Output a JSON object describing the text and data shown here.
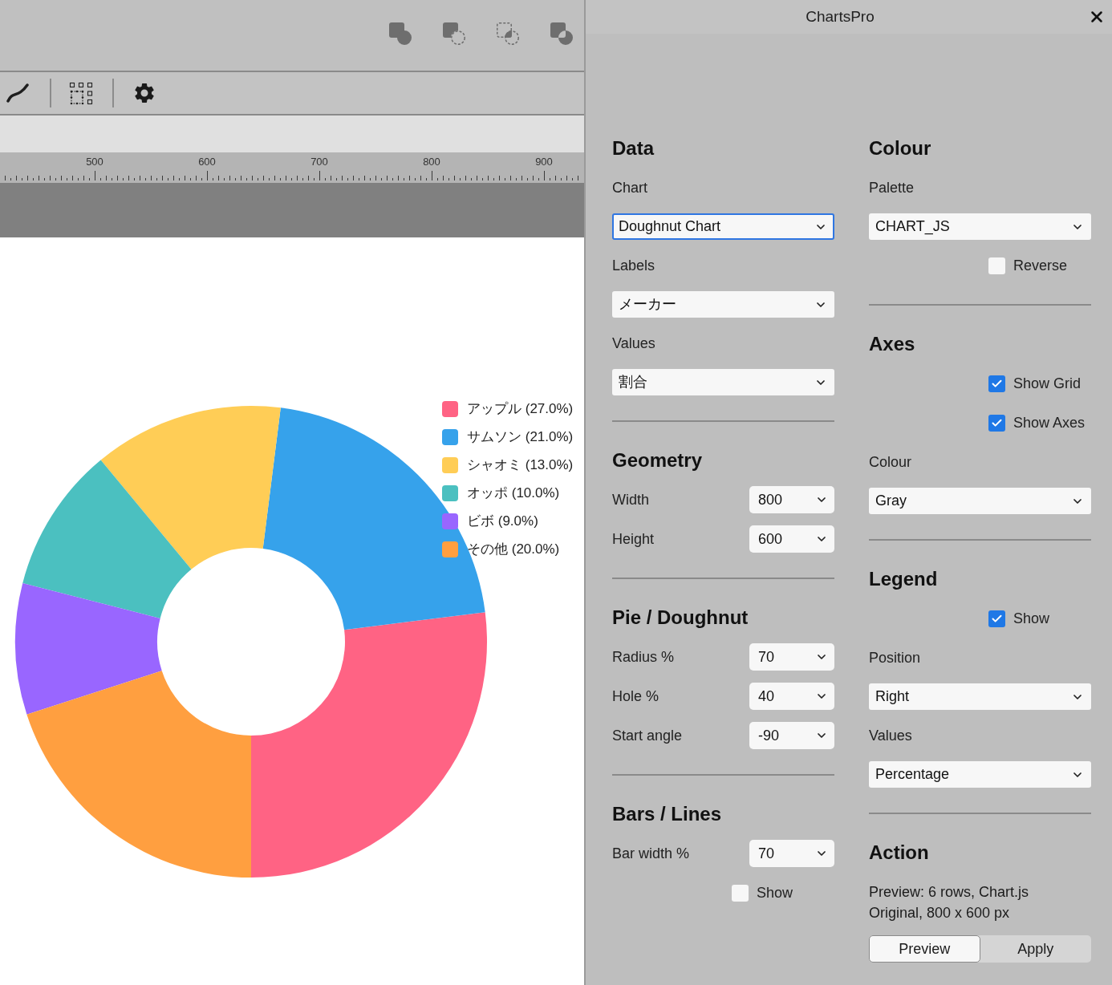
{
  "ruler": {
    "labels": [
      "500",
      "600",
      "700",
      "800",
      "900"
    ]
  },
  "chart": {
    "chart_data": {
      "type": "donut",
      "values": [
        27,
        21,
        13,
        10,
        9,
        20
      ]
    },
    "legend": [
      {
        "label": "アップル (27.0%)",
        "color": "#ff6384"
      },
      {
        "label": "サムソン (21.0%)",
        "color": "#36a2eb"
      },
      {
        "label": "シャオミ (13.0%)",
        "color": "#ffcd56"
      },
      {
        "label": "オッポ (10.0%)",
        "color": "#4bc0c0"
      },
      {
        "label": "ビボ (9.0%)",
        "color": "#9966ff"
      },
      {
        "label": "その他 (20.0%)",
        "color": "#ff9f40"
      }
    ]
  },
  "panel": {
    "title": "ChartsPro",
    "columns": [
      [
        {
          "heading": "Data",
          "items": [
            {
              "kind": "select",
              "label": "Chart",
              "value": "Doughnut Chart",
              "focused": true
            },
            {
              "kind": "select",
              "label": "Labels",
              "value": "メーカー",
              "focused": false
            },
            {
              "kind": "select",
              "label": "Values",
              "value": "割合",
              "focused": false
            }
          ]
        },
        {
          "heading": "Geometry",
          "items": [
            {
              "kind": "inline_select",
              "label": "Width",
              "value": "800"
            },
            {
              "kind": "inline_select",
              "label": "Height",
              "value": "600"
            }
          ]
        },
        {
          "heading": "Pie / Doughnut",
          "items": [
            {
              "kind": "inline_select",
              "label": "Radius %",
              "value": "70"
            },
            {
              "kind": "inline_select",
              "label": "Hole %",
              "value": "40"
            },
            {
              "kind": "inline_select",
              "label": "Start angle",
              "value": "-90"
            }
          ]
        },
        {
          "heading": "Bars / Lines",
          "items": [
            {
              "kind": "inline_select",
              "label": "Bar width %",
              "value": "70"
            },
            {
              "kind": "checkbox",
              "label": "Show",
              "checked": false
            }
          ]
        }
      ],
      [
        {
          "heading": "Colour",
          "items": [
            {
              "kind": "select",
              "label": "Palette",
              "value": "CHART_JS",
              "focused": false
            },
            {
              "kind": "checkbox",
              "label": "Reverse",
              "checked": false
            }
          ]
        },
        {
          "heading": "Axes",
          "items": [
            {
              "kind": "checkbox",
              "label": "Show Grid",
              "checked": true
            },
            {
              "kind": "checkbox",
              "label": "Show Axes",
              "checked": true
            },
            {
              "kind": "select",
              "label": "Colour",
              "value": "Gray",
              "focused": false
            }
          ]
        },
        {
          "heading": "Legend",
          "items": [
            {
              "kind": "checkbox",
              "label": "Show",
              "checked": true
            },
            {
              "kind": "select",
              "label": "Position",
              "value": "Right",
              "focused": false
            },
            {
              "kind": "select",
              "label": "Values",
              "value": "Percentage",
              "focused": false
            }
          ]
        },
        {
          "heading": "Action",
          "items": [
            {
              "kind": "text",
              "lines": [
                "Preview: 6 rows, Chart.js",
                "Original, 800 x 600 px"
              ]
            },
            {
              "kind": "segmented",
              "buttons": [
                {
                  "label": "Preview",
                  "selected": true
                },
                {
                  "label": "Apply",
                  "selected": false
                }
              ]
            }
          ]
        }
      ]
    ]
  }
}
